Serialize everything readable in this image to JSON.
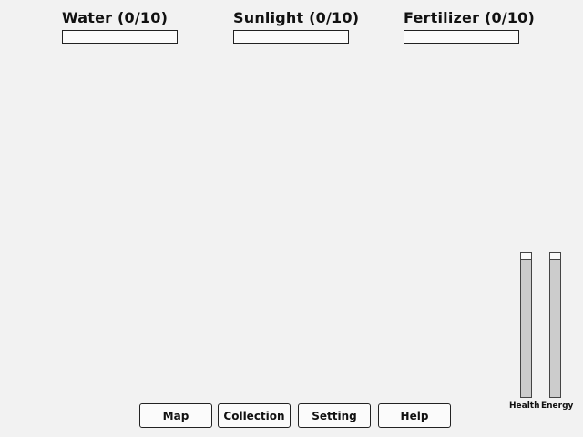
{
  "resources": [
    {
      "label": "Water (0/10)",
      "value": 0,
      "max": 10
    },
    {
      "label": "Sunlight (0/10)",
      "value": 0,
      "max": 10
    },
    {
      "label": "Fertilizer (0/10)",
      "value": 0,
      "max": 10
    }
  ],
  "stats": {
    "health": {
      "label": "Health",
      "level": 0.95
    },
    "energy": {
      "label": "Energy",
      "level": 0.95
    }
  },
  "menu": {
    "map": "Map",
    "collection": "Collection",
    "setting": "Setting",
    "help": "Help"
  },
  "colors": {
    "background": "#f2f2f2",
    "bar_border": "#222222",
    "stat_fill": "#cccccc"
  }
}
